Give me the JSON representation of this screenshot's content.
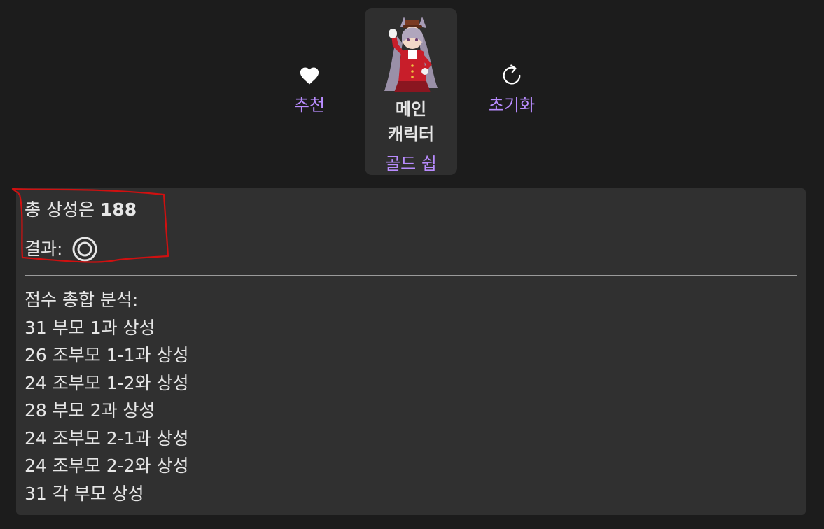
{
  "actions": {
    "recommend_label": "추천",
    "recommend_icon": "heart-icon",
    "reset_label": "초기화",
    "reset_icon": "refresh-icon"
  },
  "main_character": {
    "title": "메인 캐릭터",
    "name": "골드 쉽"
  },
  "result": {
    "total_prefix": "총 상성은 ",
    "total_value": "188",
    "result_label": "결과:",
    "result_symbol": "double-circle-icon"
  },
  "analysis": {
    "heading": "점수 총합 분석:",
    "lines": [
      "31 부모 1과 상성",
      "26 조부모 1-1과 상성",
      "24 조부모 1-2와 상성",
      "28 부모 2과 상성",
      "24 조부모 2-1과 상성",
      "24 조부모 2-2와 상성",
      "31 각 부모 상성"
    ]
  },
  "colors": {
    "background": "#1c1c1c",
    "panel": "#303030",
    "accent": "#b98cff",
    "annotation": "#d01010"
  }
}
